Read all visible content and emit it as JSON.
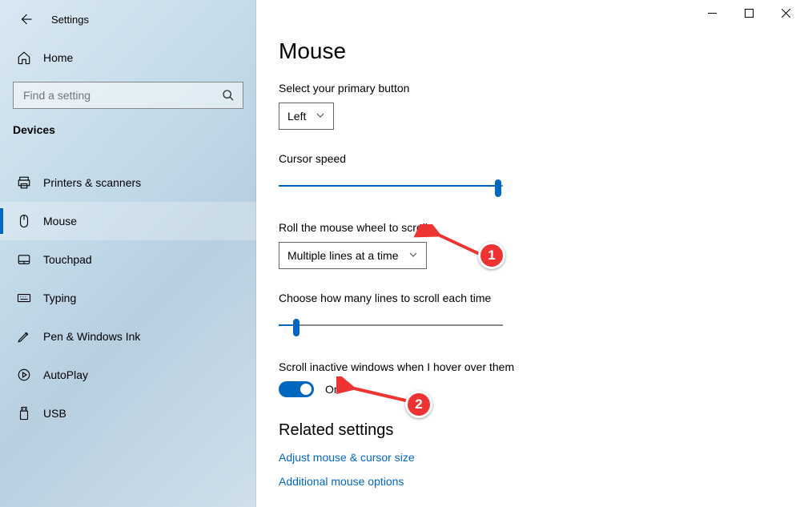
{
  "app": {
    "title": "Settings"
  },
  "sidebar": {
    "home": "Home",
    "search_placeholder": "Find a setting",
    "section": "Devices",
    "items": [
      {
        "label": "Printers & scanners"
      },
      {
        "label": "Mouse"
      },
      {
        "label": "Touchpad"
      },
      {
        "label": "Typing"
      },
      {
        "label": "Pen & Windows Ink"
      },
      {
        "label": "AutoPlay"
      },
      {
        "label": "USB"
      }
    ]
  },
  "main": {
    "title": "Mouse",
    "primary_button_label": "Select your primary button",
    "primary_button_value": "Left",
    "cursor_speed_label": "Cursor speed",
    "cursor_speed_percent": 98,
    "scroll_mode_label": "Roll the mouse wheel to scroll",
    "scroll_mode_value": "Multiple lines at a time",
    "scroll_lines_label": "Choose how many lines to scroll each time",
    "scroll_lines_percent": 8,
    "inactive_label": "Scroll inactive windows when I hover over them",
    "inactive_state": "On",
    "related_title": "Related settings",
    "link1": "Adjust mouse & cursor size",
    "link2": "Additional mouse options"
  },
  "annotations": {
    "n1": "1",
    "n2": "2"
  }
}
